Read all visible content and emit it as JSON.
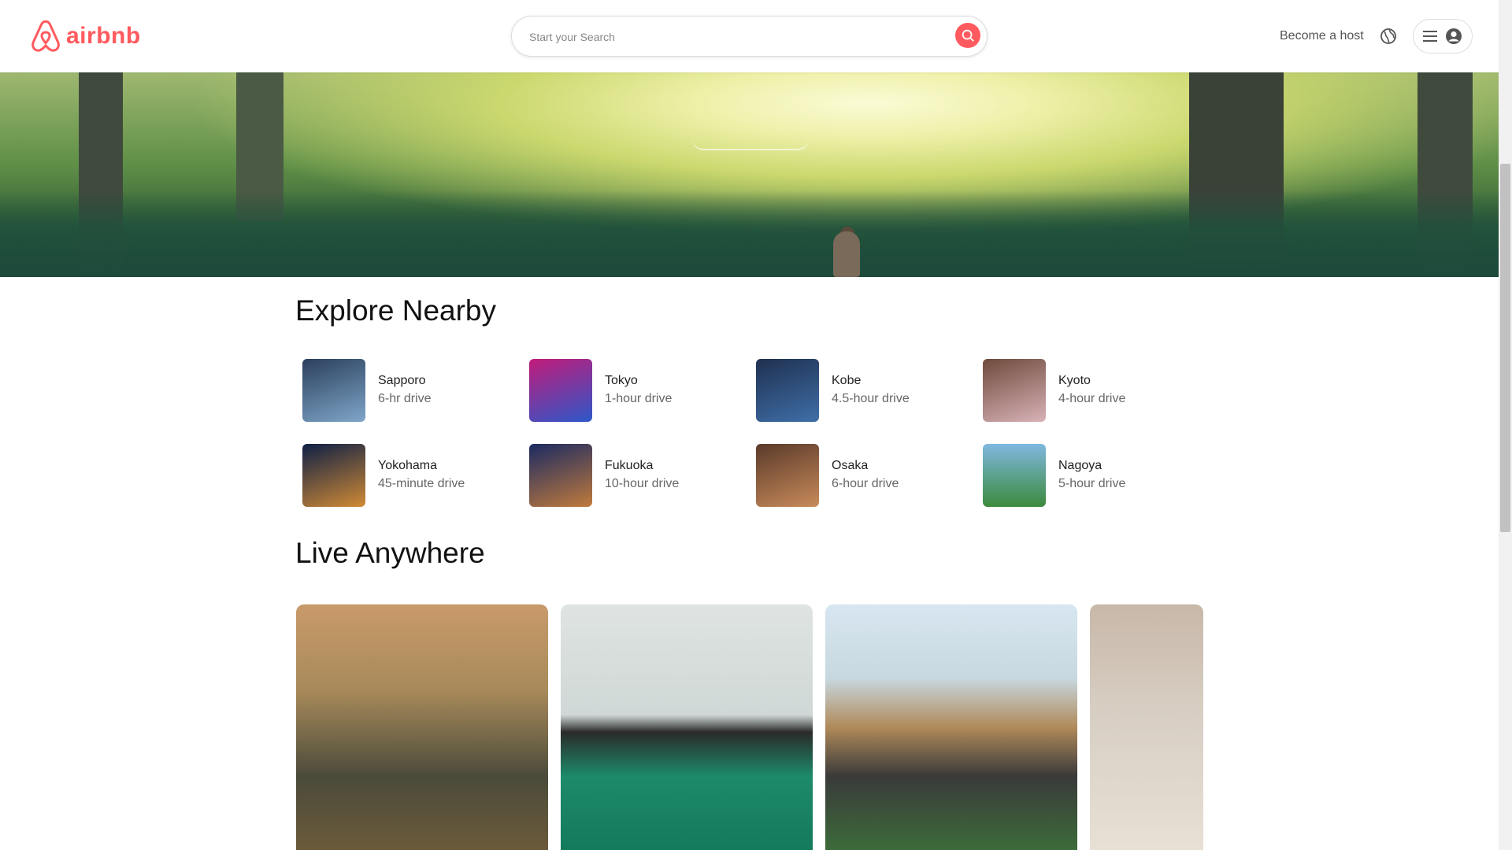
{
  "header": {
    "brand": "airbnb",
    "search_placeholder": "Start your Search",
    "become_host": "Become a host",
    "icons": {
      "logo": "airbnb-logo-icon",
      "search": "search-icon",
      "globe": "globe-icon",
      "menu": "hamburger-icon",
      "user": "user-circle-icon"
    },
    "brand_color": "#FF5A5F"
  },
  "explore": {
    "title": "Explore Nearby",
    "items": [
      {
        "city": "Sapporo",
        "distance": "6-hr drive",
        "colors": [
          "#2b3f5c",
          "#7fa6c9"
        ]
      },
      {
        "city": "Tokyo",
        "distance": "1-hour drive",
        "colors": [
          "#c21b7a",
          "#2d58c9"
        ]
      },
      {
        "city": "Kobe",
        "distance": "4.5-hour drive",
        "colors": [
          "#1f3050",
          "#3f6fa8"
        ]
      },
      {
        "city": "Kyoto",
        "distance": "4-hour drive",
        "colors": [
          "#6e4a3c",
          "#d8b2b7"
        ]
      },
      {
        "city": "Yokohama",
        "distance": "45-minute drive",
        "colors": [
          "#0e1f45",
          "#d08a35"
        ]
      },
      {
        "city": "Fukuoka",
        "distance": "10-hour drive",
        "colors": [
          "#1b2a62",
          "#c07a3c"
        ]
      },
      {
        "city": "Osaka",
        "distance": "6-hour drive",
        "colors": [
          "#5a3a2a",
          "#c88a5a"
        ]
      },
      {
        "city": "Nagoya",
        "distance": "5-hour drive",
        "colors": [
          "#7fb8e0",
          "#3c8a3c"
        ]
      }
    ]
  },
  "live": {
    "title": "Live Anywhere",
    "cards": [
      {
        "name": "cabin-house-card",
        "colors": [
          "#c99a6a",
          "#4b4b3a"
        ]
      },
      {
        "name": "floating-house-card",
        "colors": [
          "#dfe4e2",
          "#1d8a6a"
        ]
      },
      {
        "name": "a-frame-house-card",
        "colors": [
          "#d7e6f0",
          "#3d6b3a"
        ]
      },
      {
        "name": "bedroom-card",
        "colors": [
          "#c8b8a8",
          "#e8e0d4"
        ]
      }
    ]
  }
}
